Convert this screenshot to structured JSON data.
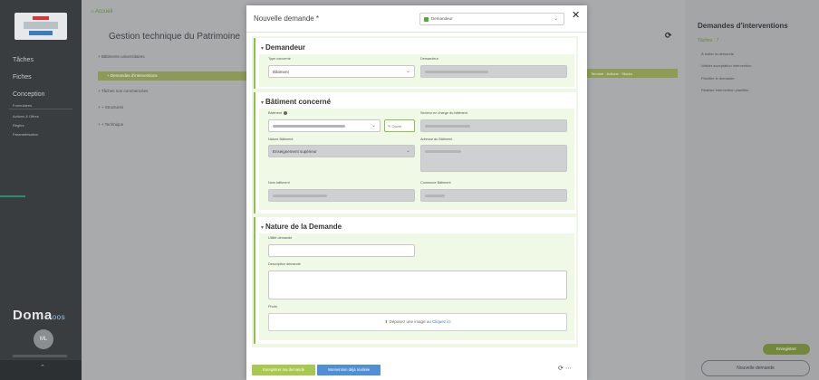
{
  "sidebar": {
    "items": [
      "Tâches",
      "Fiches",
      "Conception"
    ],
    "sub_items": [
      "Formulaires",
      "Actions & Offres",
      "Règles",
      "Paramétrisation"
    ],
    "brand_main": "Doma",
    "brand_suffix": "oos",
    "avatar_initials": "ML",
    "collapse_glyph": "⌃"
  },
  "main": {
    "breadcrumb": "Accueil",
    "title": "Gestion technique du Patrimoine",
    "tree": [
      "+  Bâtiments universitaires",
      "+  Demandes d'interventions",
      "+  Tâches non commencées",
      "+  +  Structures",
      "+  +  Technique"
    ],
    "refresh_glyph": "⟳",
    "tags": "Terminé  ·  Actions  ·  Stocks"
  },
  "right_panel": {
    "title": "Demandes d'interventions",
    "subtitle": "Tâches : 7",
    "items": [
      "À traiter la demande",
      "Valider acceptation intervention",
      "Planifier le demande",
      "Réaliser intervention planifiée"
    ],
    "btn_green": "Enregistrer",
    "btn_outline": "Nouvelle demande"
  },
  "modal": {
    "title": "Nouvelle demande *",
    "role_value": "Demandeur",
    "close_glyph": "✕",
    "sections": {
      "demandeur": {
        "title": "Demandeur",
        "type_label": "Type concerné",
        "type_value": "Bâtiment",
        "demandeur_label": "Demandeur"
      },
      "batiment": {
        "title": "Bâtiment concerné",
        "batiment_label": "Bâtiment",
        "ouvrir_label": "Ouvrir",
        "secteur_label": "Secteur en charge du bâtiment",
        "nature_label": "Nature Bâtiment",
        "nature_value": "Enseignement supérieur",
        "adresse_label": "Adresse du Bâtiment",
        "nom_label": "Nom bâtiment",
        "commune_label": "Commune Bâtiment"
      },
      "nature": {
        "title": "Nature de la Demande",
        "utilite_label": "Utilité demande",
        "description_label": "Description demande",
        "photo_label": "Photo",
        "drop_text": "Déposez une image ou",
        "drop_link": "Cliquez ici"
      }
    },
    "footer": {
      "register_label": "Enregistrer ma demande",
      "already_label": "Intervention déjà réalisée",
      "refresh_glyph": "⟳",
      "more_glyph": "⋯"
    }
  },
  "colors": {
    "accent_green": "#8cc04a",
    "modal_bg": "#eef7e3",
    "link_blue": "#3b7bbf",
    "btn_blue": "#4f8fd6",
    "btn_green": "#a7c94e"
  }
}
